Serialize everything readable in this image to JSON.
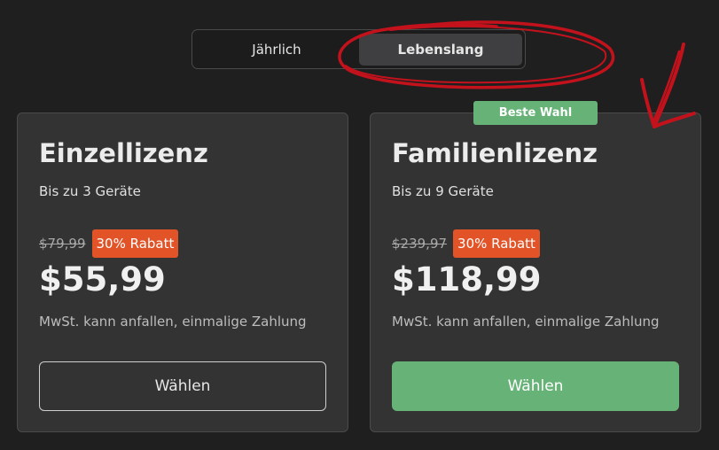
{
  "billing_toggle": {
    "options": [
      {
        "label": "Jährlich",
        "selected": false
      },
      {
        "label": "Lebenslang",
        "selected": true
      }
    ]
  },
  "plans": [
    {
      "title": "Einzellizenz",
      "devices": "Bis zu 3 Geräte",
      "old_price": "$79,99",
      "discount": "30% Rabatt",
      "price": "$55,99",
      "tax_note": "MwSt. kann anfallen, einmalige Zahlung",
      "cta": "Wählen",
      "highlighted": false
    },
    {
      "title": "Familienlizenz",
      "devices": "Bis zu 9 Geräte",
      "old_price": "$239,97",
      "discount": "30% Rabatt",
      "price": "$118,99",
      "tax_note": "MwSt. kann anfallen, einmalige Zahlung",
      "cta": "Wählen",
      "highlighted": true,
      "badge": "Beste Wahl"
    }
  ],
  "colors": {
    "background": "#1f1f20",
    "card": "#333334",
    "accent_green": "#67b277",
    "discount_orange": "#e25328",
    "annotation_red": "#c4121c"
  },
  "annotations": {
    "toggle_circle": "red-ellipse-around-lebenslang",
    "arrow": "red-arrow-pointing-to-familienlizenz-card"
  }
}
